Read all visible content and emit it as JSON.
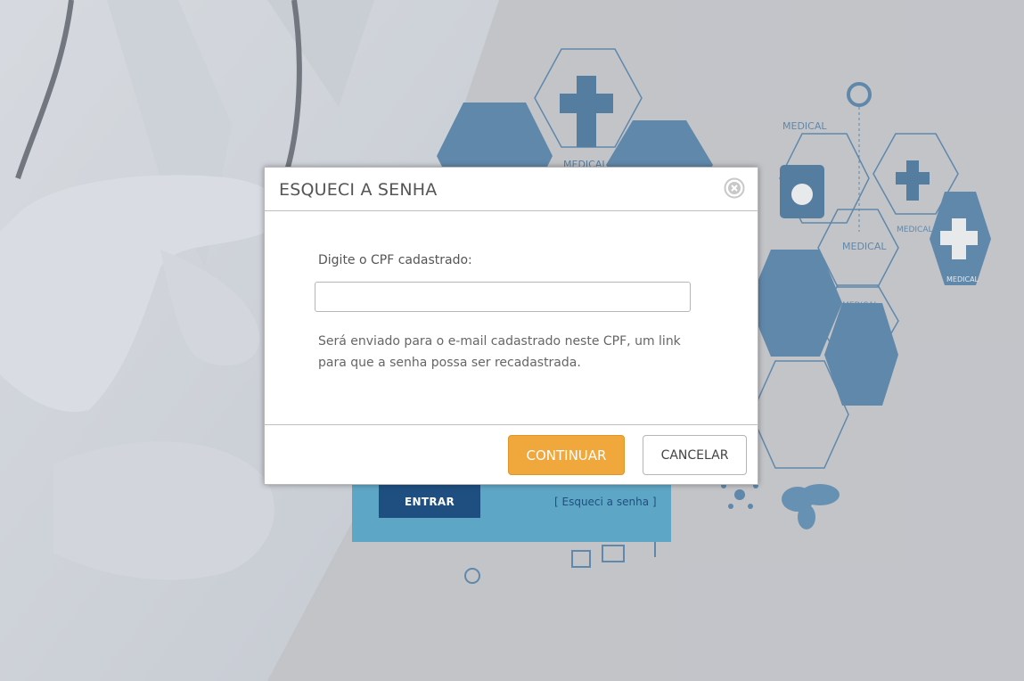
{
  "background": {
    "hex_labels": [
      "MEDICAL",
      "MEDICAL",
      "MEDICAL",
      "MEDICAL",
      "MEDICAL",
      "MEDICAL"
    ]
  },
  "login": {
    "enter_label": "ENTRAR",
    "forgot_link": "[ Esqueci a senha ]"
  },
  "modal": {
    "title": "ESQUECI A SENHA",
    "field_label": "Digite o CPF cadastrado:",
    "cpf_value": "",
    "cpf_placeholder": "",
    "info_text": "Será enviado para o e-mail cadastrado neste CPF, um link para que a senha possa ser recadastrada.",
    "continue_label": "CONTINUAR",
    "cancel_label": "CANCELAR"
  },
  "colors": {
    "accent_orange": "#f0a73c",
    "login_panel": "#5ea6c5",
    "login_button": "#1e4f80",
    "medical_blue": "#2e6a9c"
  }
}
